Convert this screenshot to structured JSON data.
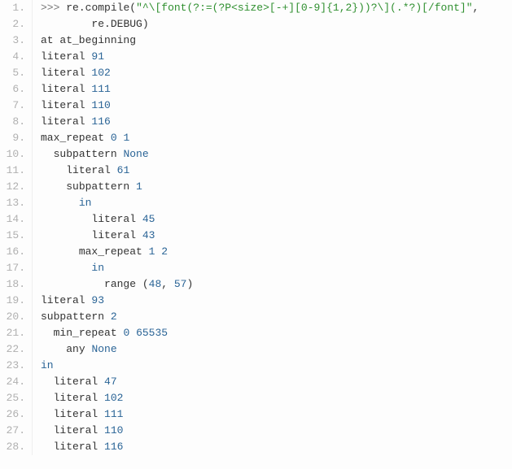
{
  "lines": [
    {
      "num": "1.",
      "segments": [
        {
          "cls": "tok-prompt",
          "t": ">>> "
        },
        {
          "cls": "tok-name",
          "t": "re"
        },
        {
          "cls": "tok-dot",
          "t": "."
        },
        {
          "cls": "tok-func",
          "t": "compile"
        },
        {
          "cls": "tok-paren",
          "t": "("
        },
        {
          "cls": "tok-string",
          "t": "\"^\\[font(?:=(?P<size>[-+][0-9]{1,2}))?\\](.*?)[/font]\""
        },
        {
          "cls": "tok-comma",
          "t": ","
        }
      ]
    },
    {
      "num": "2.",
      "segments": [
        {
          "cls": "",
          "t": "        "
        },
        {
          "cls": "tok-name",
          "t": "re"
        },
        {
          "cls": "tok-dot",
          "t": "."
        },
        {
          "cls": "tok-name",
          "t": "DEBUG"
        },
        {
          "cls": "tok-paren",
          "t": ")"
        }
      ]
    },
    {
      "num": "3.",
      "segments": [
        {
          "cls": "tok-name",
          "t": "at at_beginning"
        }
      ]
    },
    {
      "num": "4.",
      "segments": [
        {
          "cls": "tok-name",
          "t": "literal "
        },
        {
          "cls": "tok-num",
          "t": "91"
        }
      ]
    },
    {
      "num": "5.",
      "segments": [
        {
          "cls": "tok-name",
          "t": "literal "
        },
        {
          "cls": "tok-num",
          "t": "102"
        }
      ]
    },
    {
      "num": "6.",
      "segments": [
        {
          "cls": "tok-name",
          "t": "literal "
        },
        {
          "cls": "tok-num",
          "t": "111"
        }
      ]
    },
    {
      "num": "7.",
      "segments": [
        {
          "cls": "tok-name",
          "t": "literal "
        },
        {
          "cls": "tok-num",
          "t": "110"
        }
      ]
    },
    {
      "num": "8.",
      "segments": [
        {
          "cls": "tok-name",
          "t": "literal "
        },
        {
          "cls": "tok-num",
          "t": "116"
        }
      ]
    },
    {
      "num": "9.",
      "segments": [
        {
          "cls": "tok-name",
          "t": "max_repeat "
        },
        {
          "cls": "tok-num",
          "t": "0"
        },
        {
          "cls": "",
          "t": " "
        },
        {
          "cls": "tok-num",
          "t": "1"
        }
      ]
    },
    {
      "num": "10.",
      "segments": [
        {
          "cls": "",
          "t": "  "
        },
        {
          "cls": "tok-name",
          "t": "subpattern "
        },
        {
          "cls": "tok-kw",
          "t": "None"
        }
      ]
    },
    {
      "num": "11.",
      "segments": [
        {
          "cls": "",
          "t": "    "
        },
        {
          "cls": "tok-name",
          "t": "literal "
        },
        {
          "cls": "tok-num",
          "t": "61"
        }
      ]
    },
    {
      "num": "12.",
      "segments": [
        {
          "cls": "",
          "t": "    "
        },
        {
          "cls": "tok-name",
          "t": "subpattern "
        },
        {
          "cls": "tok-num",
          "t": "1"
        }
      ]
    },
    {
      "num": "13.",
      "segments": [
        {
          "cls": "",
          "t": "      "
        },
        {
          "cls": "tok-kw",
          "t": "in"
        }
      ]
    },
    {
      "num": "14.",
      "segments": [
        {
          "cls": "",
          "t": "        "
        },
        {
          "cls": "tok-name",
          "t": "literal "
        },
        {
          "cls": "tok-num",
          "t": "45"
        }
      ]
    },
    {
      "num": "15.",
      "segments": [
        {
          "cls": "",
          "t": "        "
        },
        {
          "cls": "tok-name",
          "t": "literal "
        },
        {
          "cls": "tok-num",
          "t": "43"
        }
      ]
    },
    {
      "num": "16.",
      "segments": [
        {
          "cls": "",
          "t": "      "
        },
        {
          "cls": "tok-name",
          "t": "max_repeat "
        },
        {
          "cls": "tok-num",
          "t": "1"
        },
        {
          "cls": "",
          "t": " "
        },
        {
          "cls": "tok-num",
          "t": "2"
        }
      ]
    },
    {
      "num": "17.",
      "segments": [
        {
          "cls": "",
          "t": "        "
        },
        {
          "cls": "tok-kw",
          "t": "in"
        }
      ]
    },
    {
      "num": "18.",
      "segments": [
        {
          "cls": "",
          "t": "          "
        },
        {
          "cls": "tok-name",
          "t": "range "
        },
        {
          "cls": "tok-paren",
          "t": "("
        },
        {
          "cls": "tok-num",
          "t": "48"
        },
        {
          "cls": "tok-comma",
          "t": ", "
        },
        {
          "cls": "tok-num",
          "t": "57"
        },
        {
          "cls": "tok-paren",
          "t": ")"
        }
      ]
    },
    {
      "num": "19.",
      "segments": [
        {
          "cls": "tok-name",
          "t": "literal "
        },
        {
          "cls": "tok-num",
          "t": "93"
        }
      ]
    },
    {
      "num": "20.",
      "segments": [
        {
          "cls": "tok-name",
          "t": "subpattern "
        },
        {
          "cls": "tok-num",
          "t": "2"
        }
      ]
    },
    {
      "num": "21.",
      "segments": [
        {
          "cls": "",
          "t": "  "
        },
        {
          "cls": "tok-name",
          "t": "min_repeat "
        },
        {
          "cls": "tok-num",
          "t": "0"
        },
        {
          "cls": "",
          "t": " "
        },
        {
          "cls": "tok-num",
          "t": "65535"
        }
      ]
    },
    {
      "num": "22.",
      "segments": [
        {
          "cls": "",
          "t": "    "
        },
        {
          "cls": "tok-name",
          "t": "any "
        },
        {
          "cls": "tok-kw",
          "t": "None"
        }
      ]
    },
    {
      "num": "23.",
      "segments": [
        {
          "cls": "tok-kw",
          "t": "in"
        }
      ]
    },
    {
      "num": "24.",
      "segments": [
        {
          "cls": "",
          "t": "  "
        },
        {
          "cls": "tok-name",
          "t": "literal "
        },
        {
          "cls": "tok-num",
          "t": "47"
        }
      ]
    },
    {
      "num": "25.",
      "segments": [
        {
          "cls": "",
          "t": "  "
        },
        {
          "cls": "tok-name",
          "t": "literal "
        },
        {
          "cls": "tok-num",
          "t": "102"
        }
      ]
    },
    {
      "num": "26.",
      "segments": [
        {
          "cls": "",
          "t": "  "
        },
        {
          "cls": "tok-name",
          "t": "literal "
        },
        {
          "cls": "tok-num",
          "t": "111"
        }
      ]
    },
    {
      "num": "27.",
      "segments": [
        {
          "cls": "",
          "t": "  "
        },
        {
          "cls": "tok-name",
          "t": "literal "
        },
        {
          "cls": "tok-num",
          "t": "110"
        }
      ]
    },
    {
      "num": "28.",
      "segments": [
        {
          "cls": "",
          "t": "  "
        },
        {
          "cls": "tok-name",
          "t": "literal "
        },
        {
          "cls": "tok-num",
          "t": "116"
        }
      ]
    }
  ]
}
